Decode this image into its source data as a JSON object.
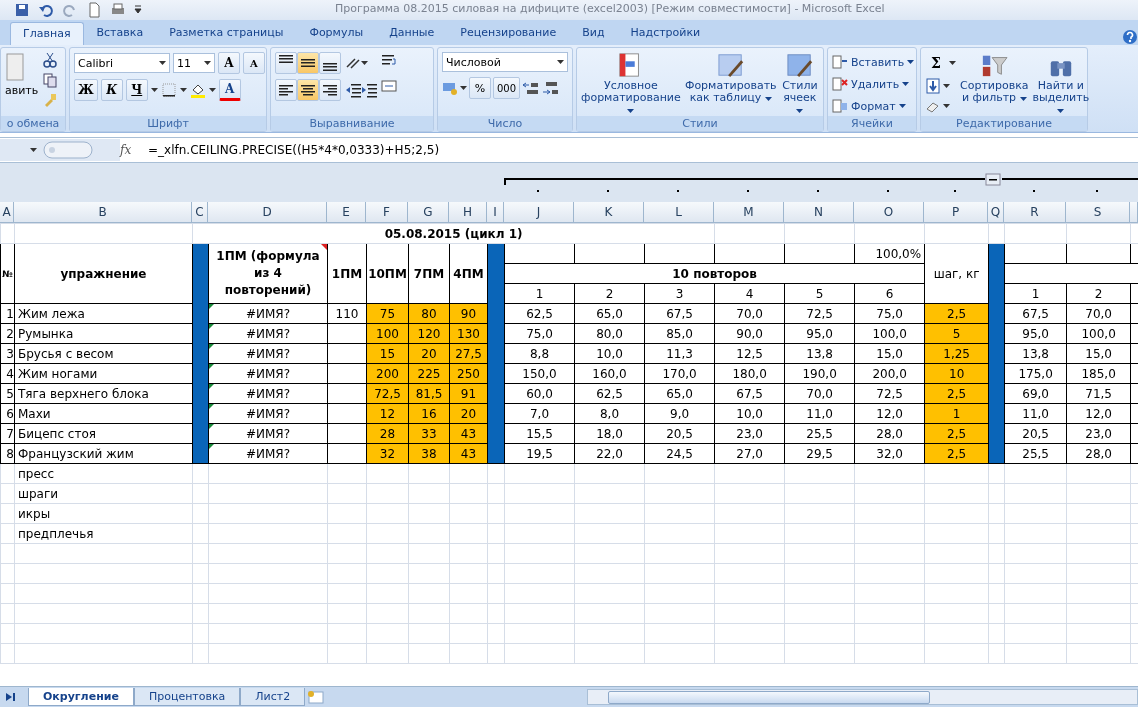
{
  "window": {
    "title": "Программа 08.2015 силовая на дифиците (excel2003)  [Режим совместимости]  - Microsoft Excel"
  },
  "ribbon_tabs": [
    {
      "label": "Главная",
      "selected": true
    },
    {
      "label": "Вставка",
      "selected": false
    },
    {
      "label": "Разметка страницы",
      "selected": false
    },
    {
      "label": "Формулы",
      "selected": false
    },
    {
      "label": "Данные",
      "selected": false
    },
    {
      "label": "Рецензирование",
      "selected": false
    },
    {
      "label": "Вид",
      "selected": false
    },
    {
      "label": "Надстройки",
      "selected": false
    }
  ],
  "clipboard": {
    "label": "о обмена",
    "paste_label": "авить"
  },
  "font": {
    "label": "Шрифт",
    "font_name": "Calibri",
    "font_size": "11",
    "grow": "A",
    "shrink": "A",
    "bold": "Ж",
    "italic": "К",
    "underline": "Ч",
    "font_color": "A"
  },
  "alignment": {
    "label": "Выравнивание",
    "vertical": [
      {
        "selected": false
      },
      {
        "selected": true
      },
      {
        "selected": false
      }
    ],
    "horizontal": [
      {
        "selected": false
      },
      {
        "selected": true
      },
      {
        "selected": false
      }
    ]
  },
  "number": {
    "label": "Число",
    "format": "Числовой",
    "percent": "%",
    "thousands": "000"
  },
  "styles": {
    "label": "Стили",
    "buttons": [
      "Условное форматирование",
      "Форматировать как таблицу",
      "Стили ячеек"
    ]
  },
  "cells": {
    "label": "Ячейки",
    "buttons": [
      "Вставить",
      "Удалить",
      "Формат"
    ]
  },
  "editing": {
    "label": "Редактирование",
    "sum": "Σ",
    "buttons": [
      "Сортировка и фильтр",
      "Найти и выделить"
    ]
  },
  "formula_bar": {
    "function_label": "fx",
    "formula": "=_xlfn.CEILING.PRECISE((H5*4*0,0333)+H5;2,5)"
  },
  "columns": [
    "A",
    "B",
    "C",
    "D",
    "E",
    "F",
    "G",
    "H",
    "I",
    "J",
    "K",
    "L",
    "M",
    "N",
    "O",
    "P",
    "Q",
    "R",
    "S"
  ],
  "sheet": {
    "title": "05.08.2015 (цикл 1)",
    "num_header": "№",
    "exercise_header": "упражнение",
    "formula_header": "1ПМ (формула из 4 повторений)",
    "rm_headers": [
      "1ПМ",
      "10ПМ",
      "7ПМ",
      "4ПМ"
    ],
    "percent": "100,0%",
    "reps_header": "10 повторов",
    "set_numbers": [
      "1",
      "2",
      "3",
      "4",
      "5",
      "6"
    ],
    "step_header": "шаг, кг",
    "next_set_numbers": [
      "1",
      "2"
    ],
    "rows": [
      {
        "num": "1",
        "exercise": "Жим лежа",
        "formula_result": "#ИМЯ?",
        "one_rm": "110",
        "rm": [
          "75",
          "80",
          "90"
        ],
        "sets": [
          "62,5",
          "65,0",
          "67,5",
          "70,0",
          "72,5",
          "75,0"
        ],
        "step": "2,5",
        "next": [
          "67,5",
          "70,0"
        ]
      },
      {
        "num": "2",
        "exercise": "Румынка",
        "formula_result": "#ИМЯ?",
        "rm": [
          "100",
          "120",
          "130"
        ],
        "sets": [
          "75,0",
          "80,0",
          "85,0",
          "90,0",
          "95,0",
          "100,0"
        ],
        "step": "5",
        "next": [
          "95,0",
          "100,0"
        ]
      },
      {
        "num": "3",
        "exercise": "Брусья с весом",
        "formula_result": "#ИМЯ?",
        "rm": [
          "15",
          "20",
          "27,5"
        ],
        "sets": [
          "8,8",
          "10,0",
          "11,3",
          "12,5",
          "13,8",
          "15,0"
        ],
        "step": "1,25",
        "next": [
          "13,8",
          "15,0"
        ]
      },
      {
        "num": "4",
        "exercise": "Жим ногами",
        "formula_result": "#ИМЯ?",
        "rm": [
          "200",
          "225",
          "250"
        ],
        "sets": [
          "150,0",
          "160,0",
          "170,0",
          "180,0",
          "190,0",
          "200,0"
        ],
        "step": "10",
        "next": [
          "175,0",
          "185,0"
        ]
      },
      {
        "num": "5",
        "exercise": "Тяга верхнего блока",
        "formula_result": "#ИМЯ?",
        "rm": [
          "72,5",
          "81,5",
          "91"
        ],
        "sets": [
          "60,0",
          "62,5",
          "65,0",
          "67,5",
          "70,0",
          "72,5"
        ],
        "step": "2,5",
        "next": [
          "69,0",
          "71,5"
        ]
      },
      {
        "num": "6",
        "exercise": "Махи",
        "formula_result": "#ИМЯ?",
        "rm": [
          "12",
          "16",
          "20"
        ],
        "sets": [
          "7,0",
          "8,0",
          "9,0",
          "10,0",
          "11,0",
          "12,0"
        ],
        "step": "1",
        "next": [
          "11,0",
          "12,0"
        ]
      },
      {
        "num": "7",
        "exercise": "Бицепс стоя",
        "formula_result": "#ИМЯ?",
        "rm": [
          "28",
          "33",
          "43"
        ],
        "sets": [
          "15,5",
          "18,0",
          "20,5",
          "23,0",
          "25,5",
          "28,0"
        ],
        "step": "2,5",
        "next": [
          "20,5",
          "23,0"
        ]
      },
      {
        "num": "8",
        "exercise": "Французский жим",
        "formula_result": "#ИМЯ?",
        "rm": [
          "32",
          "38",
          "43"
        ],
        "sets": [
          "19,5",
          "22,0",
          "24,5",
          "27,0",
          "29,5",
          "32,0"
        ],
        "step": "2,5",
        "next": [
          "25,5",
          "28,0"
        ]
      }
    ],
    "extra_rows": [
      "пресс",
      "шраги",
      "икры",
      "предплечья"
    ]
  },
  "sheet_tabs": [
    {
      "label": "Округление",
      "selected": true
    },
    {
      "label": "Процентовка",
      "selected": false
    },
    {
      "label": "Лист2",
      "selected": false
    }
  ]
}
